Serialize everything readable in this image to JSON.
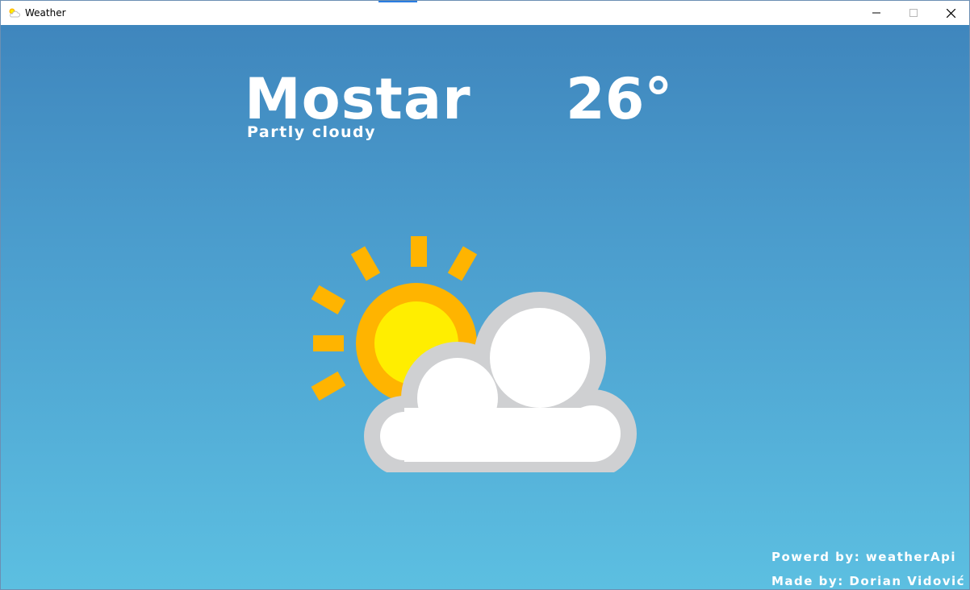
{
  "window": {
    "title": "Weather",
    "app_icon": "partly-cloudy-icon",
    "controls": [
      "minimize-icon",
      "maximize-icon",
      "close-icon"
    ]
  },
  "weather": {
    "city": "Mostar",
    "temperature": "26°",
    "condition": "Partly cloudy",
    "icon": "partly-cloudy-icon"
  },
  "footer": {
    "powered_by": "Powerd by: weatherApi",
    "made_by": "Made by: Dorian Vidović"
  },
  "colors": {
    "sky_top": "#3f86bd",
    "sky_bottom": "#5cbfe1",
    "sun_outer": "#ffb400",
    "sun_inner": "#ffee00",
    "cloud_outline": "#cfd0d2",
    "cloud_fill": "#ffffff"
  }
}
